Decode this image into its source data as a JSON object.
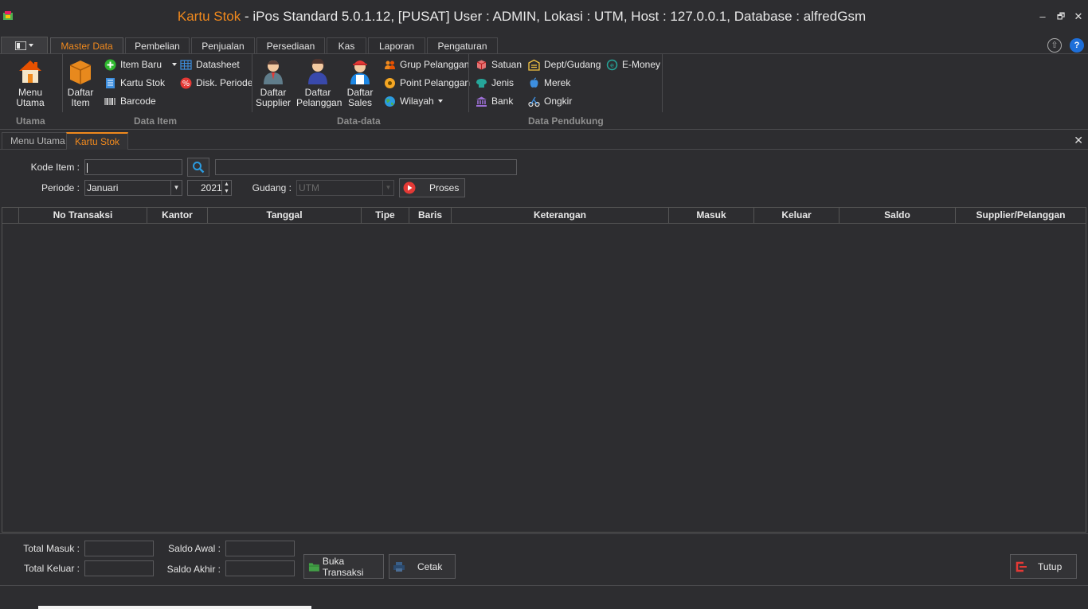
{
  "window": {
    "title_accent": "Kartu Stok",
    "title_rest": " - iPos Standard 5.0.1.12, [PUSAT] User : ADMIN, Lokasi : UTM, Host : 127.0.0.1, Database : alfredGsm",
    "minimize_glyph": "–",
    "restore_glyph": "🗗",
    "close_glyph": "✕"
  },
  "ribbon": {
    "tabs": [
      "Master Data",
      "Pembelian",
      "Penjualan",
      "Persediaan",
      "Kas",
      "Laporan",
      "Pengaturan"
    ],
    "active_tab": "Master Data",
    "groups": {
      "utama": {
        "label": "Utama",
        "menu_utama": "Menu Utama"
      },
      "data_item": {
        "label": "Data Item",
        "daftar_item_1": "Daftar",
        "daftar_item_2": "Item",
        "item_baru": "Item Baru",
        "kartu_stok": "Kartu Stok",
        "barcode": "Barcode",
        "datasheet": "Datasheet",
        "disk_periode": "Disk. Periode"
      },
      "data_data": {
        "label": "Data-data",
        "daftar_supplier_1": "Daftar",
        "daftar_supplier_2": "Supplier",
        "daftar_pelanggan_1": "Daftar",
        "daftar_pelanggan_2": "Pelanggan",
        "daftar_sales_1": "Daftar",
        "daftar_sales_2": "Sales",
        "grup_pelanggan": "Grup Pelanggan",
        "point_pelanggan": "Point Pelanggan",
        "wilayah": "Wilayah"
      },
      "data_pendukung": {
        "label": "Data Pendukung",
        "satuan": "Satuan",
        "jenis": "Jenis",
        "bank": "Bank",
        "dept_gudang": "Dept/Gudang",
        "merek": "Merek",
        "ongkir": "Ongkir",
        "e_money": "E-Money"
      }
    }
  },
  "doc_tabs": [
    "Menu Utama",
    "Kartu Stok"
  ],
  "form": {
    "kode_item_label": "Kode Item :",
    "kode_item_value": "",
    "item_name_value": "",
    "periode_label": "Periode :",
    "periode_value": "Januari",
    "year_value": "2021",
    "gudang_label": "Gudang :",
    "gudang_value": "UTM",
    "proses_label": "Proses"
  },
  "grid": {
    "columns": [
      "No Transaksi",
      "Kantor",
      "Tanggal",
      "Tipe",
      "Baris",
      "Keterangan",
      "Masuk",
      "Keluar",
      "Saldo",
      "Supplier/Pelanggan"
    ],
    "rows": []
  },
  "footer": {
    "total_masuk_label": "Total Masuk :",
    "total_keluar_label": "Total Keluar :",
    "saldo_awal_label": "Saldo Awal :",
    "saldo_akhir_label": "Saldo Akhir :",
    "total_masuk_value": "",
    "total_keluar_value": "",
    "saldo_awal_value": "",
    "saldo_akhir_value": "",
    "buka_transaksi": "Buka Transaksi",
    "cetak": "Cetak",
    "tutup": "Tutup"
  },
  "colors": {
    "accent": "#f0891d",
    "background": "#2d2d30"
  }
}
